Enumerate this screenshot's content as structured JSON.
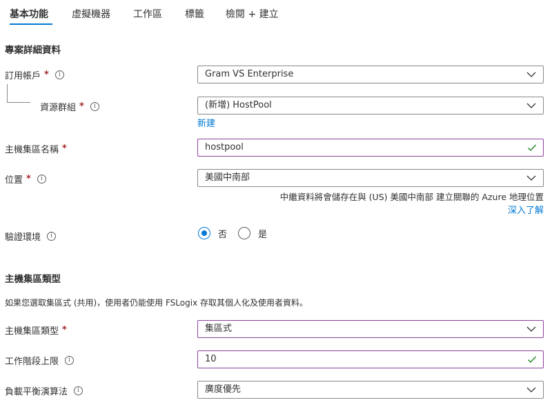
{
  "tabs": [
    "基本功能",
    "虛擬機器",
    "工作區",
    "標籤",
    "檢閱 + 建立"
  ],
  "colors": {
    "accent": "#0078d4",
    "required": "#a4262c",
    "valid_border": "#8a3f9c",
    "valid_check": "#107c10"
  },
  "project": {
    "title": "專案詳細資料",
    "subscription": {
      "label": "訂用帳戶",
      "value": "Gram VS Enterprise"
    },
    "resource_group": {
      "label": "資源群組",
      "value": "(新增) HostPool",
      "new_link": "新建"
    }
  },
  "hostpool_name": {
    "label": "主機集區名稱",
    "value": "hostpool"
  },
  "location": {
    "label": "位置",
    "value": "美國中南部",
    "note": "中繼資料將會儲存在與 (US) 美國中南部 建立關聯的 Azure 地理位置",
    "learn_more": "深入了解"
  },
  "validation_env": {
    "label": "驗證環境",
    "options": [
      "否",
      "是"
    ],
    "selected": "否"
  },
  "hostpool_type": {
    "title": "主機集區類型",
    "description": "如果您選取集區式 (共用)，使用者仍能使用 FSLogix 存取其個人化及使用者資料。",
    "type": {
      "label": "主機集區類型",
      "value": "集區式"
    },
    "session_limit": {
      "label": "工作階段上限",
      "value": "10"
    },
    "load_balancing": {
      "label": "負載平衡演算法",
      "value": "廣度優先"
    }
  },
  "symbols": {
    "required": "*",
    "info": "i"
  }
}
